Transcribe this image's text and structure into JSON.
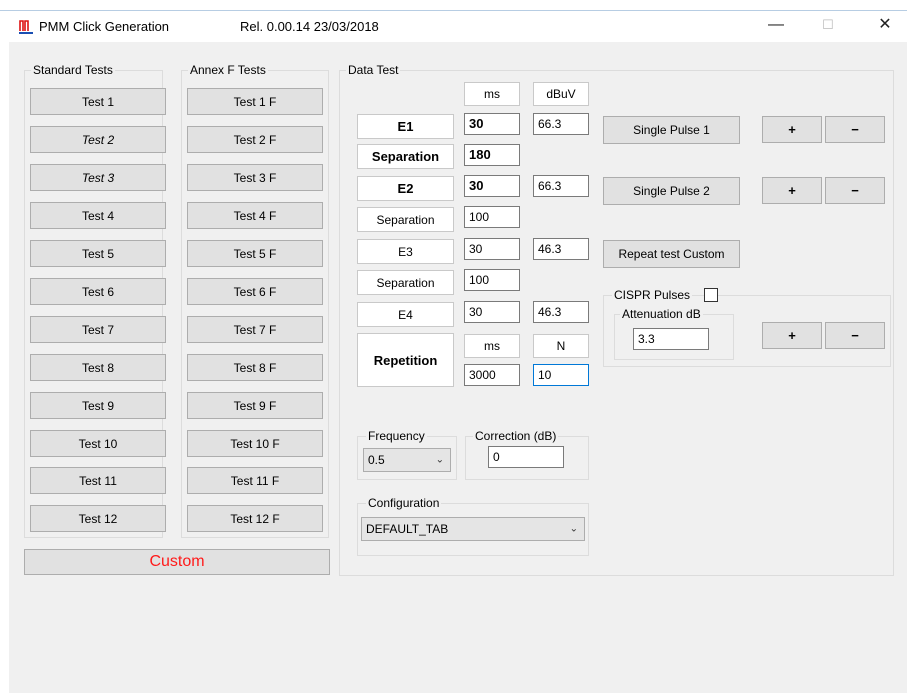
{
  "titlebar": {
    "app_title": "PMM Click Generation",
    "release": "Rel. 0.00.14 23/03/2018",
    "minimize": "—",
    "maximize": "☐",
    "close": "✕"
  },
  "standard_tests": {
    "legend": "Standard  Tests",
    "buttons": [
      "Test 1",
      "Test 2",
      "Test 3",
      "Test 4",
      "Test 5",
      "Test 6",
      "Test 7",
      "Test 8",
      "Test 9",
      "Test 10",
      "Test 11",
      "Test 12"
    ]
  },
  "annex_tests": {
    "legend": "Annex F Tests",
    "buttons": [
      "Test 1 F",
      "Test 2 F",
      "Test 3 F",
      "Test 4 F",
      "Test 5 F",
      "Test 6 F",
      "Test 7 F",
      "Test 8 F",
      "Test 9 F",
      "Test 10 F",
      "Test 11 F",
      "Test 12 F"
    ]
  },
  "custom_button": "Custom",
  "data_test": {
    "legend": "Data Test",
    "col_ms": "ms",
    "col_dbuv": "dBuV",
    "e1": {
      "label": "E1",
      "ms": "30",
      "dbuv": "66.3"
    },
    "sep1": {
      "label": "Separation",
      "value": "180"
    },
    "e2": {
      "label": "E2",
      "ms": "30",
      "dbuv": "66.3"
    },
    "sep2": {
      "label": "Separation",
      "value": "100"
    },
    "e3": {
      "label": "E3",
      "ms": "30",
      "dbuv": "46.3"
    },
    "sep3": {
      "label": "Separation",
      "value": "100"
    },
    "e4": {
      "label": "E4",
      "ms": "30",
      "dbuv": "46.3"
    },
    "repetition": {
      "label": "Repetition",
      "col_ms": "ms",
      "col_n": "N",
      "ms": "3000",
      "n": "10"
    },
    "single_pulse_1": "Single Pulse 1",
    "single_pulse_2": "Single Pulse 2",
    "repeat_custom": "Repeat test Custom",
    "plus": "+",
    "minus": "−",
    "cispr": {
      "label": "CISPR Pulses",
      "attenuation_label": "Attenuation dB",
      "attenuation": "3.3"
    },
    "frequency": {
      "legend": "Frequency",
      "value": "0.5"
    },
    "correction": {
      "legend": "Correction (dB)",
      "value": "0"
    },
    "configuration": {
      "legend": "Configuration",
      "value": "DEFAULT_TAB"
    }
  },
  "colors": {
    "custom_text": "#ff1a1a",
    "focus_border": "#0078d7"
  }
}
